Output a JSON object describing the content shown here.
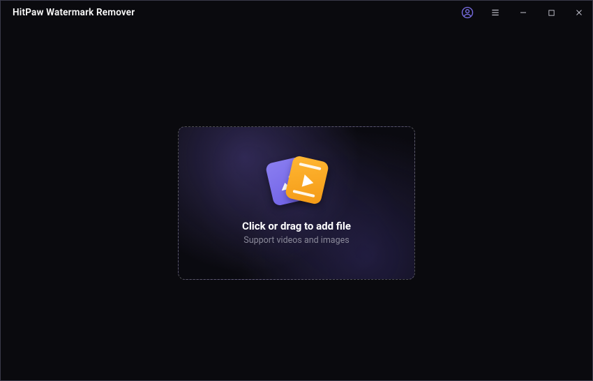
{
  "titlebar": {
    "title": "HitPaw Watermark Remover"
  },
  "dropzone": {
    "title": "Click or drag to add file",
    "subtitle": "Support videos and images"
  }
}
